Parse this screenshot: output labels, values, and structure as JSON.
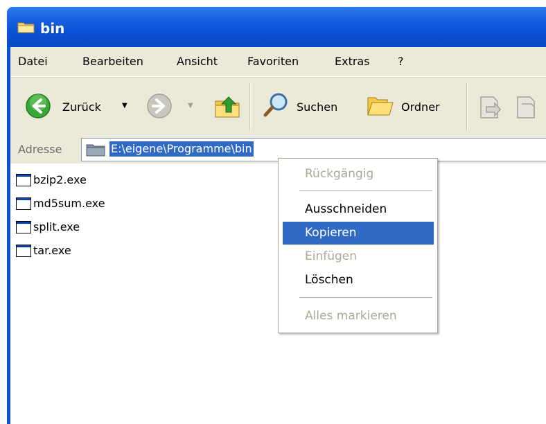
{
  "window": {
    "title": "bin"
  },
  "menu": {
    "items": [
      {
        "label": "Datei"
      },
      {
        "label": "Bearbeiten"
      },
      {
        "label": "Ansicht"
      },
      {
        "label": "Favoriten"
      },
      {
        "label": "Extras"
      },
      {
        "label": "?"
      }
    ]
  },
  "toolbar": {
    "back_label": "Zurück",
    "search_label": "Suchen",
    "folders_label": "Ordner"
  },
  "address": {
    "label": "Adresse",
    "path": "E:\\eigene\\Programme\\bin"
  },
  "files": [
    {
      "name": "bzip2.exe"
    },
    {
      "name": "md5sum.exe"
    },
    {
      "name": "split.exe"
    },
    {
      "name": "tar.exe"
    }
  ],
  "context_menu": {
    "undo": "Rückgängig",
    "cut": "Ausschneiden",
    "copy": "Kopieren",
    "paste": "Einfügen",
    "delete": "Löschen",
    "select_all": "Alles markieren"
  },
  "colors": {
    "titlebar": "#0a52d6",
    "selection": "#316ac5",
    "chrome": "#ece9d8",
    "disabled_text": "#aca899"
  }
}
